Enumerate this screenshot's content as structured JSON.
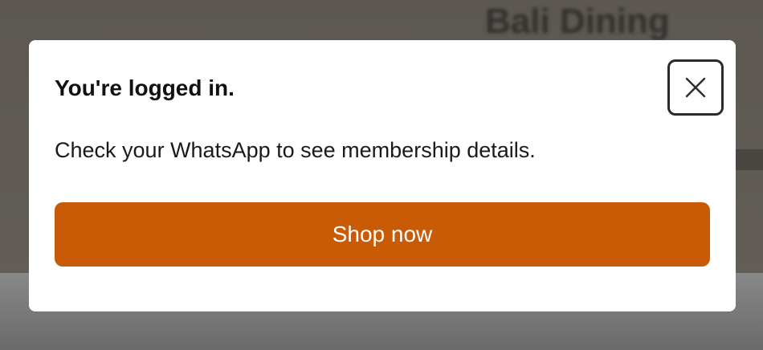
{
  "background": {
    "heading": "Bali Dining"
  },
  "modal": {
    "title": "You're logged in.",
    "message": "Check your WhatsApp to see membership details.",
    "close_icon": "close-icon",
    "primary_button_label": "Shop now"
  },
  "colors": {
    "primary_button": "#c95b07",
    "modal_background": "#ffffff",
    "backdrop": "#5f5a54"
  }
}
